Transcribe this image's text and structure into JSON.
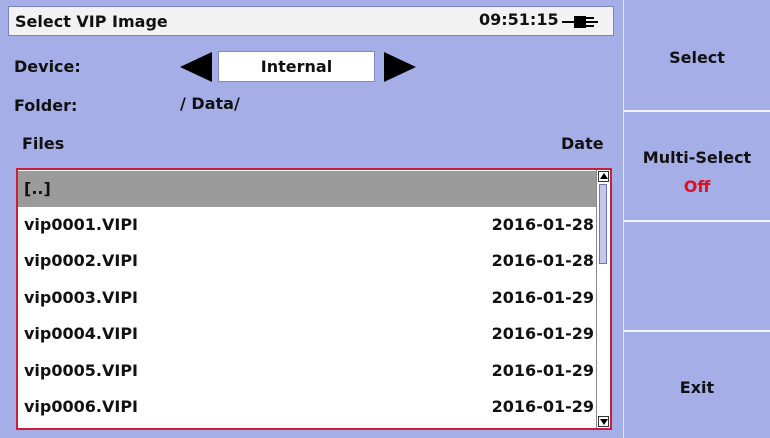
{
  "titlebar": {
    "title": "Select VIP Image",
    "time": "09:51:15"
  },
  "device": {
    "label": "Device:",
    "value": "Internal"
  },
  "folder": {
    "label": "Folder:",
    "path": "/ Data/"
  },
  "columns": {
    "files": "Files",
    "date": "Date"
  },
  "files": [
    {
      "name": "[..]",
      "date": ""
    },
    {
      "name": "vip0001.VIPI",
      "date": "2016-01-28"
    },
    {
      "name": "vip0002.VIPI",
      "date": "2016-01-28"
    },
    {
      "name": "vip0003.VIPI",
      "date": "2016-01-29"
    },
    {
      "name": "vip0004.VIPI",
      "date": "2016-01-29"
    },
    {
      "name": "vip0005.VIPI",
      "date": "2016-01-29"
    },
    {
      "name": "vip0006.VIPI",
      "date": "2016-01-29"
    }
  ],
  "sidebar": {
    "select": "Select",
    "multi_select": "Multi-Select",
    "multi_select_state": "Off",
    "exit": "Exit"
  },
  "colors": {
    "background": "#a6aee8",
    "selection_border": "#c8203a",
    "off": "#e0101e"
  }
}
